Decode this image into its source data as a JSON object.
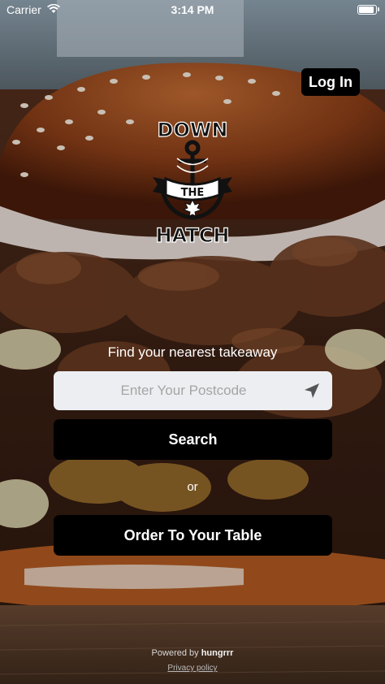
{
  "status_bar": {
    "carrier": "Carrier",
    "time": "3:14 PM",
    "battery_level": 1.0
  },
  "header": {
    "login_label": "Log In"
  },
  "logo": {
    "line1": "DOWN",
    "line2": "THE",
    "line3": "HATCH"
  },
  "main": {
    "find_text": "Find your nearest takeaway",
    "postcode_placeholder": "Enter Your Postcode",
    "postcode_value": "",
    "search_label": "Search",
    "or_text": "or",
    "order_label": "Order To Your Table"
  },
  "footer": {
    "powered_prefix": "Powered by",
    "powered_brand": "hungrrr",
    "privacy_label": "Privacy policy"
  },
  "icons": {
    "wifi": "wifi-icon",
    "location": "location-arrow-icon",
    "battery": "battery-icon"
  },
  "colors": {
    "button_bg": "#000000",
    "button_text": "#ffffff",
    "input_bg": "#eceef1",
    "placeholder": "#a5a5a5"
  }
}
